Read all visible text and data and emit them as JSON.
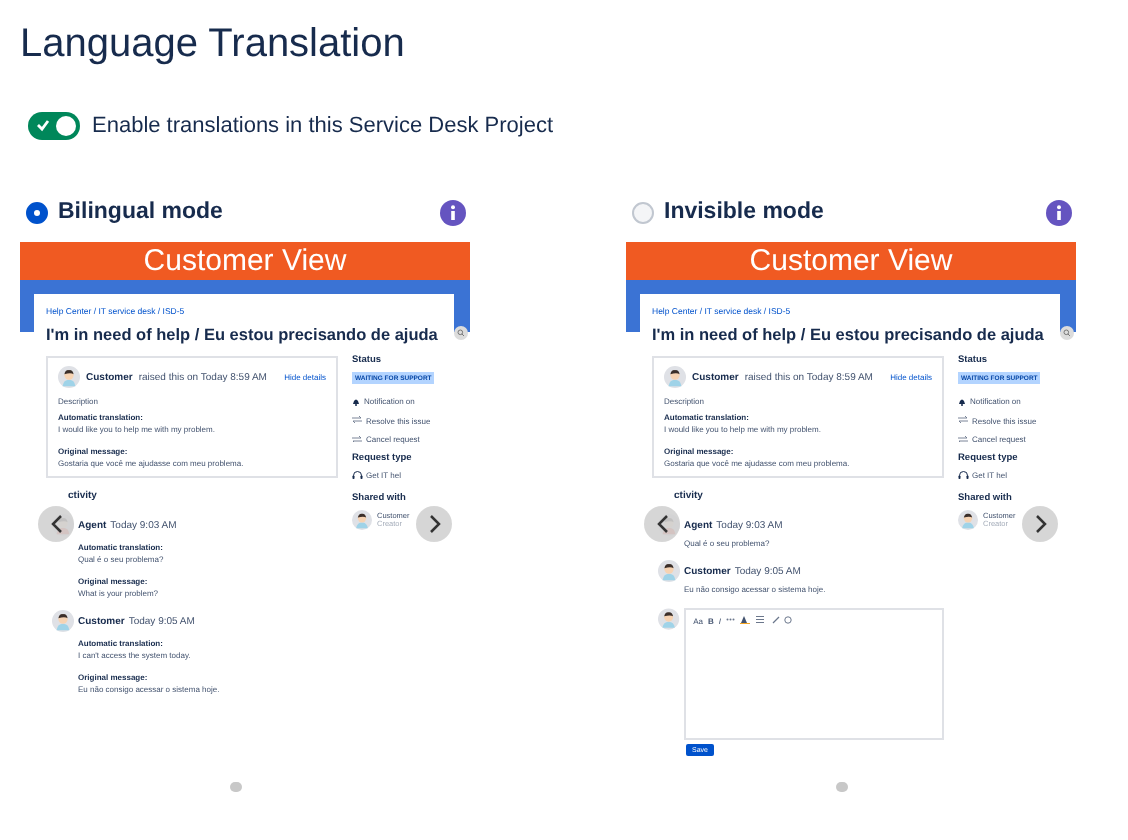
{
  "title": "Language Translation",
  "toggle": {
    "label": "Enable translations in this Service Desk Project",
    "on": true
  },
  "modes": [
    {
      "label": "Bilingual mode",
      "selected": true,
      "preview": {
        "banner": "Customer View",
        "breadcrumb": "Help Center / IT service desk / ISD-5",
        "heading": "I'm in need of help / Eu estou precisando de ajuda",
        "request": {
          "author": "Customer",
          "meta": "raised this on Today 8:59 AM",
          "link": "Hide details",
          "description": "Description",
          "blocks": [
            {
              "label": "Automatic translation:",
              "text": "I would like you to help me with my problem."
            },
            {
              "label": "Original message:",
              "text": "Gostaria que você me ajudasse com meu problema."
            }
          ]
        },
        "activity": "ctivity",
        "comments": [
          {
            "kind": "agent",
            "author": "Agent",
            "time": "Today 9:03 AM",
            "blocks": [
              {
                "label": "Automatic translation:",
                "text": "Qual é o seu problema?"
              },
              {
                "label": "Original message:",
                "text": "What is your problem?"
              }
            ]
          },
          {
            "kind": "customer",
            "author": "Customer",
            "time": "Today 9:05 AM",
            "blocks": [
              {
                "label": "Automatic translation:",
                "text": "I can't access the system today."
              },
              {
                "label": "Original message:",
                "text": "Eu não consigo acessar o sistema hoje."
              }
            ]
          }
        ],
        "sidebar": {
          "status_label": "Status",
          "status": "WAITING FOR SUPPORT",
          "actions": [
            {
              "kind": "bell",
              "label": "Notification on"
            },
            {
              "kind": "arrows",
              "label": "Resolve this issue"
            },
            {
              "kind": "arrows",
              "label": "Cancel request"
            }
          ],
          "request_type_label": "Request type",
          "request_type": "Get IT hel",
          "shared_label": "Shared with",
          "shared_name": "Customer",
          "shared_role": "Creator"
        }
      }
    },
    {
      "label": "Invisible mode",
      "selected": false,
      "preview": {
        "banner": "Customer View",
        "breadcrumb": "Help Center / IT service desk / ISD-5",
        "heading": "I'm in need of help / Eu estou precisando de ajuda",
        "request": {
          "author": "Customer",
          "meta": "raised this on Today 8:59 AM",
          "link": "Hide details",
          "description": "Description",
          "blocks": [
            {
              "label": "Automatic translation:",
              "text": "I would like you to help me with my problem."
            },
            {
              "label": "Original message:",
              "text": "Gostaria que você me ajudasse com meu problema."
            }
          ]
        },
        "activity": "ctivity",
        "comments": [
          {
            "kind": "agent",
            "author": "Agent",
            "time": "Today 9:03 AM",
            "text": "Qual é o seu problema?"
          },
          {
            "kind": "customer",
            "author": "Customer",
            "time": "Today 9:05 AM",
            "text": "Eu não consigo acessar o sistema hoje."
          }
        ],
        "editor": {
          "toolbar": [
            "Aa",
            "B",
            "I"
          ],
          "save": "Save"
        },
        "sidebar": {
          "status_label": "Status",
          "status": "WAITING FOR SUPPORT",
          "actions": [
            {
              "kind": "bell",
              "label": "Notification on"
            },
            {
              "kind": "arrows",
              "label": "Resolve this issue"
            },
            {
              "kind": "arrows",
              "label": "Cancel request"
            }
          ],
          "request_type_label": "Request type",
          "request_type": "Get IT hel",
          "shared_label": "Shared with",
          "shared_name": "Customer",
          "shared_role": "Creator"
        }
      }
    }
  ]
}
